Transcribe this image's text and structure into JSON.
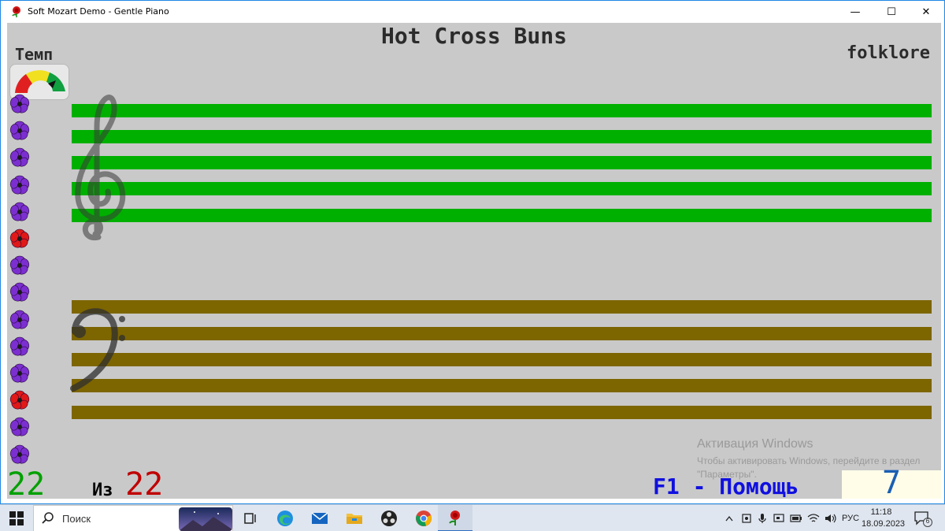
{
  "window": {
    "title": "Soft Mozart Demo - Gentle Piano",
    "minimize_glyph": "—",
    "maximize_glyph": "☐",
    "close_glyph": "✕"
  },
  "song": {
    "title": "Hot Cross Buns",
    "composer": "folklore"
  },
  "tempo": {
    "label": "Темп"
  },
  "flowers": {
    "colors": [
      "purple",
      "purple",
      "purple",
      "purple",
      "purple",
      "red",
      "purple",
      "purple",
      "purple",
      "purple",
      "purple",
      "red",
      "purple",
      "purple"
    ],
    "purple": "#7b2fd0",
    "red": "#e01818"
  },
  "staff": {
    "treble_color": "#00b000",
    "bass_color": "#7d6500"
  },
  "progress": {
    "current": "22",
    "of_label": "Из",
    "total": "22"
  },
  "help": {
    "hint": "F1 - Помощь"
  },
  "score": {
    "value": "7"
  },
  "activation": {
    "title": "Активация Windows",
    "text": "Чтобы активировать Windows, перейдите в раздел \"Параметры\"."
  },
  "taskbar": {
    "search_placeholder": "Поиск",
    "apps": [
      "task-view",
      "edge",
      "mail",
      "file-explorer",
      "obs",
      "chrome",
      "soft-mozart"
    ],
    "tray": {
      "language": "РУС",
      "time": "11:18",
      "date": "18.09.2023",
      "notifications": "6"
    }
  }
}
